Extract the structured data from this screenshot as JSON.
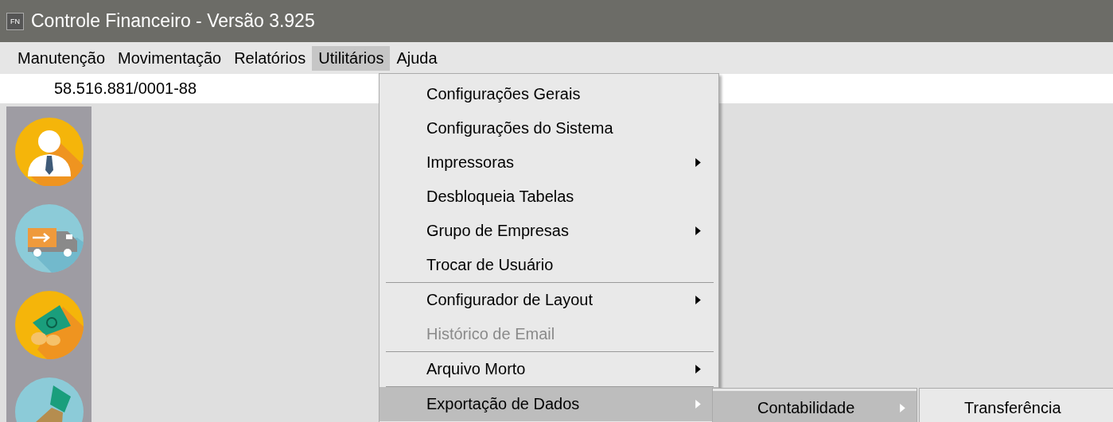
{
  "window": {
    "title": "Controle Financeiro - Versão 3.925",
    "app_badge": "FN"
  },
  "menubar": [
    {
      "label": "Manutenção",
      "selected": false
    },
    {
      "label": "Movimentação",
      "selected": false
    },
    {
      "label": "Relatórios",
      "selected": false
    },
    {
      "label": "Utilitários",
      "selected": true
    },
    {
      "label": "Ajuda",
      "selected": false
    }
  ],
  "company_id": "58.516.881/0001-88",
  "dropdown": {
    "items": [
      {
        "kind": "item",
        "label": "Configurações Gerais",
        "submenu": false,
        "disabled": false,
        "selected": false
      },
      {
        "kind": "item",
        "label": "Configurações do Sistema",
        "submenu": false,
        "disabled": false,
        "selected": false
      },
      {
        "kind": "item",
        "label": "Impressoras",
        "submenu": true,
        "disabled": false,
        "selected": false
      },
      {
        "kind": "item",
        "label": "Desbloqueia Tabelas",
        "submenu": false,
        "disabled": false,
        "selected": false
      },
      {
        "kind": "item",
        "label": "Grupo de Empresas",
        "submenu": true,
        "disabled": false,
        "selected": false
      },
      {
        "kind": "item",
        "label": "Trocar de Usuário",
        "submenu": false,
        "disabled": false,
        "selected": false
      },
      {
        "kind": "separator"
      },
      {
        "kind": "item",
        "label": "Configurador de Layout",
        "submenu": true,
        "disabled": false,
        "selected": false
      },
      {
        "kind": "item",
        "label": "Histórico de Email",
        "submenu": false,
        "disabled": true,
        "selected": false
      },
      {
        "kind": "separator"
      },
      {
        "kind": "item",
        "label": "Arquivo Morto",
        "submenu": true,
        "disabled": false,
        "selected": false
      },
      {
        "kind": "separator"
      },
      {
        "kind": "item",
        "label": "Exportação de Dados",
        "submenu": true,
        "disabled": false,
        "selected": true
      }
    ]
  },
  "submenus": [
    {
      "items": [
        {
          "label": "Contabilidade",
          "submenu": true,
          "selected": true
        }
      ]
    },
    {
      "items": [
        {
          "label": "Transferência",
          "submenu": false,
          "selected": false
        }
      ]
    }
  ]
}
